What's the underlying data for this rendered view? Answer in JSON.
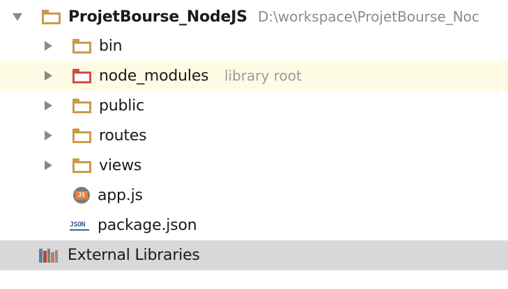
{
  "colors": {
    "folder": "#c99a4c",
    "excluded_folder": "#d04c47",
    "highlight_row": "#fdfbe3",
    "selected_row": "#d8d8d8",
    "hint_text": "#9a9a9a"
  },
  "project": {
    "name": "ProjetBourse_NodeJS",
    "path": "D:\\workspace\\ProjetBourse_Noc",
    "icon": "folder-icon",
    "expanded": true
  },
  "items": [
    {
      "label": "bin",
      "icon": "folder-icon",
      "expandable": true
    },
    {
      "label": "node_modules",
      "hint": "library root",
      "icon": "folder-icon",
      "expandable": true
    },
    {
      "label": "public",
      "icon": "folder-icon",
      "expandable": true
    },
    {
      "label": "routes",
      "icon": "folder-icon",
      "expandable": true
    },
    {
      "label": "views",
      "icon": "folder-icon",
      "expandable": true
    },
    {
      "label": "app.js",
      "icon": "javascript-file-icon",
      "badge": "JS",
      "expandable": false
    },
    {
      "label": "package.json",
      "icon": "json-file-icon",
      "badge": "JSON",
      "expandable": false
    }
  ],
  "external_libraries": {
    "label": "External Libraries",
    "icon": "library-icon"
  }
}
